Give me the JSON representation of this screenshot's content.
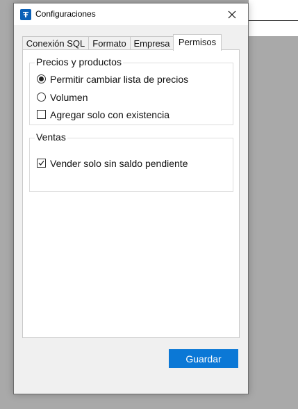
{
  "window": {
    "title": "Configuraciones",
    "app_icon": "app-icon",
    "close_icon": "close-icon"
  },
  "tabs": [
    {
      "label": "Conexión SQL",
      "active": false
    },
    {
      "label": "Formato",
      "active": false
    },
    {
      "label": "Empresa",
      "active": false
    },
    {
      "label": "Permisos",
      "active": true
    }
  ],
  "groups": {
    "precios": {
      "title": "Precios y productos",
      "options": [
        {
          "type": "radio",
          "label": "Permitir cambiar lista de precios",
          "checked": true
        },
        {
          "type": "radio",
          "label": "Volumen",
          "checked": false
        },
        {
          "type": "checkbox",
          "label": "Agregar solo con existencia",
          "checked": false
        }
      ]
    },
    "ventas": {
      "title": "Ventas",
      "options": [
        {
          "type": "checkbox",
          "label": "Vender solo sin saldo pendiente",
          "checked": true
        }
      ]
    }
  },
  "buttons": {
    "save_label": "Guardar"
  },
  "colors": {
    "accent": "#0b78d6",
    "window_bg": "#f0f0f0",
    "desktop_bg": "#a9a9a9"
  }
}
